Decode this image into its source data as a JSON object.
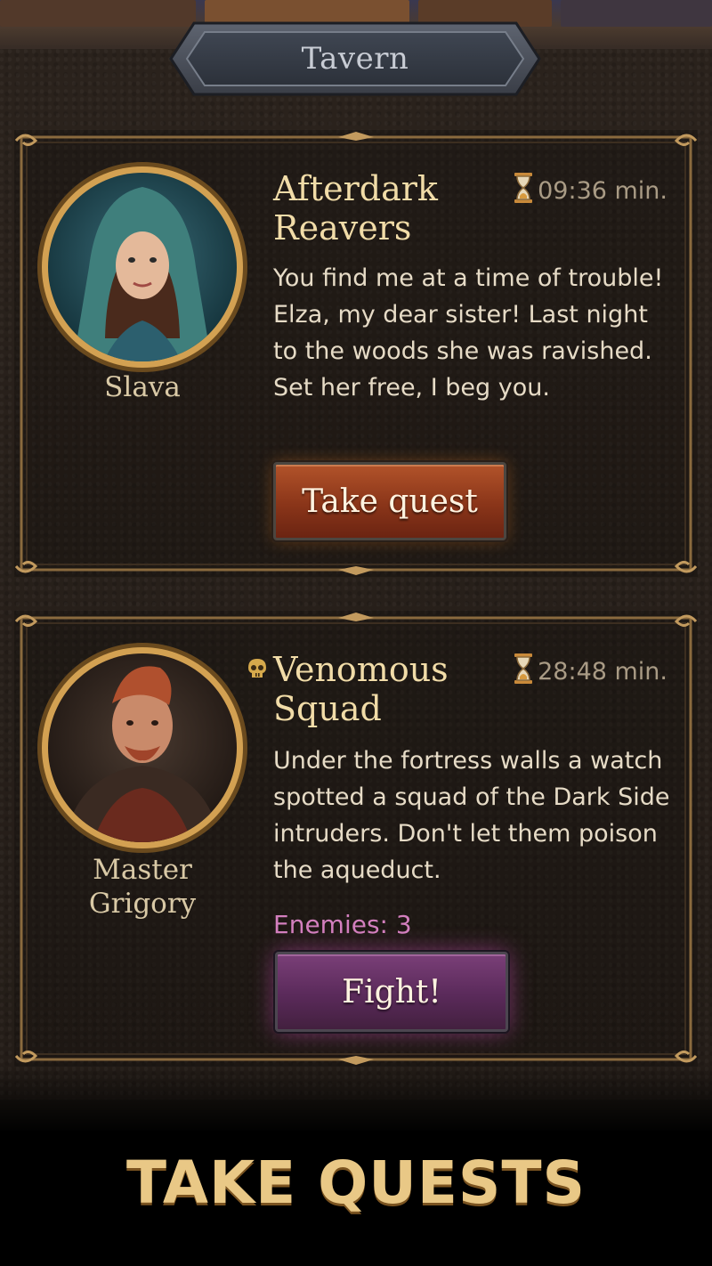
{
  "header": {
    "title": "Tavern"
  },
  "quests": [
    {
      "npc_name": "Slava",
      "title": "Afterdark Reavers",
      "title_line1": "Afterdark",
      "title_line2": "Reavers",
      "timer": "09:36 min.",
      "description": "You find me at a time of trouble! Elza, my dear sister! Last night to the woods she was ravished. Set her free, I beg you.",
      "button_label": "Take quest"
    },
    {
      "npc_name": "Master Grigory",
      "npc_line1": "Master",
      "npc_line2": "Grigory",
      "title": "Venomous Squad",
      "title_line1": "Venomous",
      "title_line2": "Squad",
      "timer": "28:48 min.",
      "description": "Under the fortress walls a watch spotted a squad of the Dark Side intruders. Don't let them poison the aqueduct.",
      "enemies": "Enemies: 3",
      "button_label": "Fight!"
    }
  ],
  "promo": {
    "text": "TAKE QUESTS"
  },
  "colors": {
    "gold_frame": "#b8925a",
    "title_gold": "#f1dca8",
    "take_button": "#8a3519",
    "fight_button": "#5a2a5a",
    "enemies_text": "#d37fbe",
    "timer_text": "#a99b85"
  },
  "icons": {
    "timer": "hourglass-icon",
    "danger": "skull-icon"
  }
}
